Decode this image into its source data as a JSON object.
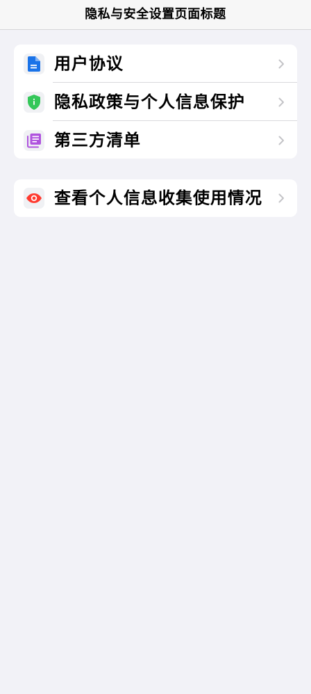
{
  "header": {
    "title": "隐私与安全设置页面标题"
  },
  "settings_group": {
    "items": [
      {
        "label": "用户协议",
        "icon": "document-icon",
        "icon_color": "#1a73e8"
      },
      {
        "label": "隐私政策与个人信息保护",
        "icon": "shield-icon",
        "icon_color": "#34c759"
      },
      {
        "label": "第三方清单",
        "icon": "list-icon",
        "icon_color": "#af52de"
      }
    ]
  },
  "privacy_group": {
    "items": [
      {
        "label": "查看个人信息收集使用情况■",
        "icon": "eye-icon",
        "icon_color": "#ff3b30"
      }
    ]
  },
  "colors": {
    "background": "#f2f2f7",
    "card": "#ffffff",
    "chevron": "#c4c4c7"
  }
}
